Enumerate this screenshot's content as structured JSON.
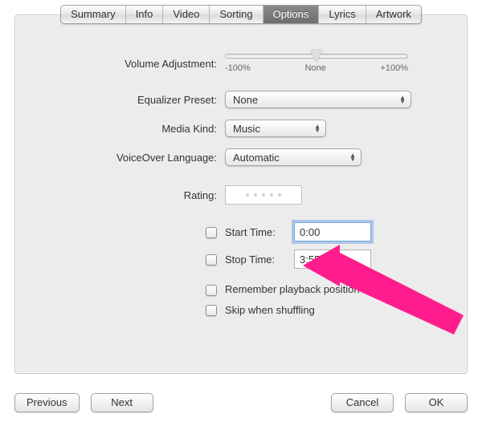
{
  "tabs": {
    "summary": "Summary",
    "info": "Info",
    "video": "Video",
    "sorting": "Sorting",
    "options": "Options",
    "lyrics": "Lyrics",
    "artwork": "Artwork"
  },
  "labels": {
    "volume": "Volume Adjustment:",
    "eq": "Equalizer Preset:",
    "media_kind": "Media Kind:",
    "voiceover": "VoiceOver Language:",
    "rating": "Rating:",
    "start_time": "Start Time:",
    "stop_time": "Stop Time:",
    "remember": "Remember playback position",
    "skip": "Skip when shuffling"
  },
  "slider": {
    "left": "-100%",
    "mid": "None",
    "right": "+100%"
  },
  "values": {
    "eq": "None",
    "media_kind": "Music",
    "voiceover": "Automatic",
    "start_time": "0:00",
    "stop_time": "3:55.493"
  },
  "buttons": {
    "previous": "Previous",
    "next": "Next",
    "cancel": "Cancel",
    "ok": "OK"
  }
}
